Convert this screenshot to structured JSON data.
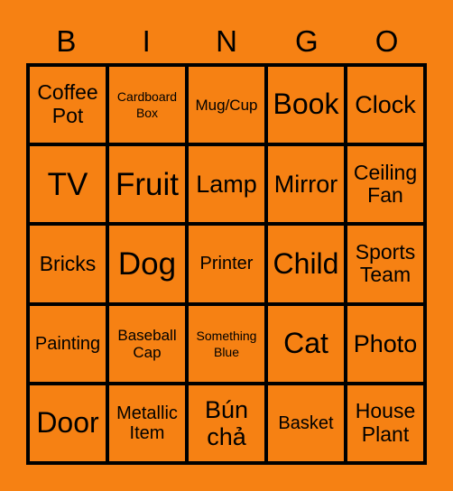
{
  "header": [
    "B",
    "I",
    "N",
    "G",
    "O"
  ],
  "cells": [
    "Coffee Pot",
    "Cardboard Box",
    "Mug/Cup",
    "Book",
    "Clock",
    "TV",
    "Fruit",
    "Lamp",
    "Mirror",
    "Ceiling Fan",
    "Bricks",
    "Dog",
    "Printer",
    "Child",
    "Sports Team",
    "Painting",
    "Baseball Cap",
    "Something Blue",
    "Cat",
    "Photo",
    "Door",
    "Metallic Item",
    "Bún chả",
    "Basket",
    "House Plant"
  ],
  "colors": {
    "background": "#F68113",
    "lines": "#000000"
  }
}
